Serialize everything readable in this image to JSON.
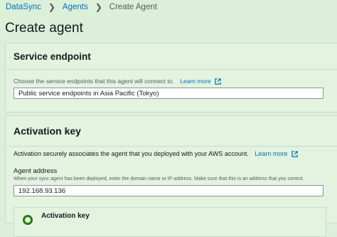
{
  "breadcrumb": {
    "items": [
      "DataSync",
      "Agents",
      "Create Agent"
    ]
  },
  "page_title": "Create agent",
  "service_endpoint": {
    "title": "Service endpoint",
    "description": "Choose the service endpoints that this agent will connect to.",
    "learn_more": "Learn more",
    "selected": "Public service endpoints in Asia Pacific (Tokyo)"
  },
  "activation_key": {
    "title": "Activation key",
    "description": "Activation securely associates the agent that you deployed with your AWS account.",
    "learn_more": "Learn more",
    "agent_address_label": "Agent address",
    "agent_address_hint": "When your sync agent has been deployed, enter the domain name or IP address. Make sure that this is an address that you control.",
    "agent_address_value": "192.168.93.136",
    "option_title": "Activation key"
  },
  "colors": {
    "link": "#0073bb",
    "accent_green": "#1d8102"
  }
}
